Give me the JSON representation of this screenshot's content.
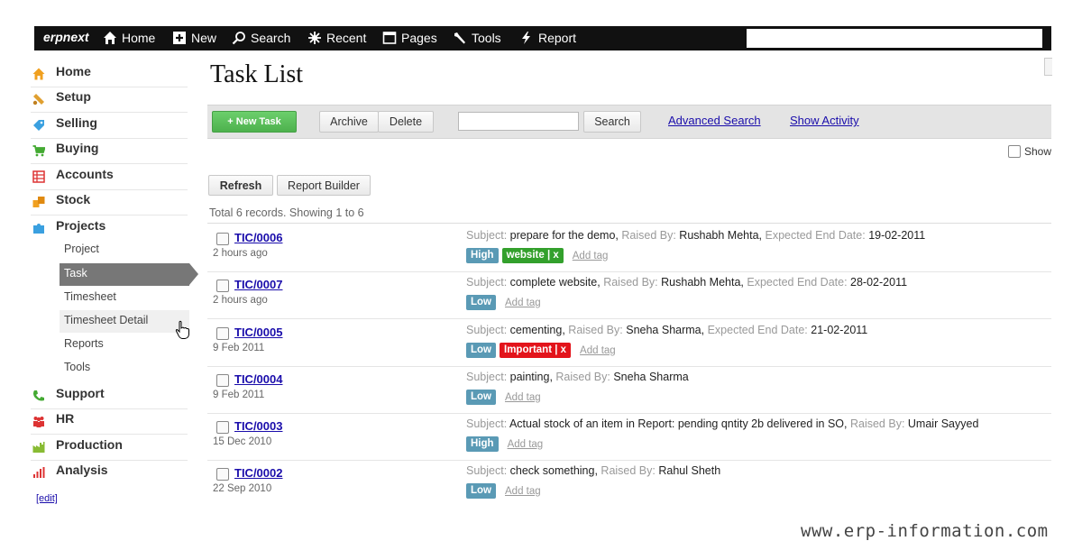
{
  "topbar": {
    "brand": "erpnext",
    "nav": [
      {
        "label": "Home",
        "icon": "home-icon"
      },
      {
        "label": "New",
        "icon": "plus-icon"
      },
      {
        "label": "Search",
        "icon": "search-icon"
      },
      {
        "label": "Recent",
        "icon": "star-icon"
      },
      {
        "label": "Pages",
        "icon": "page-icon"
      },
      {
        "label": "Tools",
        "icon": "wrench-icon"
      },
      {
        "label": "Report",
        "icon": "lightning-icon"
      }
    ]
  },
  "sidebar": {
    "items": [
      {
        "label": "Home",
        "icon": "home-icon",
        "color": "#f0a020"
      },
      {
        "label": "Setup",
        "icon": "tools-icon",
        "color": "#e0a030"
      },
      {
        "label": "Selling",
        "icon": "tag-icon",
        "color": "#3aa0e0"
      },
      {
        "label": "Buying",
        "icon": "cart-icon",
        "color": "#44aa33"
      },
      {
        "label": "Accounts",
        "icon": "ledger-icon",
        "color": "#dd3333"
      },
      {
        "label": "Stock",
        "icon": "boxes-icon",
        "color": "#f0a020"
      },
      {
        "label": "Projects",
        "icon": "puzzle-icon",
        "color": "#3aa0e0"
      }
    ],
    "subitems": [
      {
        "label": "Project"
      },
      {
        "label": "Task",
        "active": true
      },
      {
        "label": "Timesheet"
      },
      {
        "label": "Timesheet Detail"
      },
      {
        "label": "Reports"
      },
      {
        "label": "Tools"
      }
    ],
    "items_after": [
      {
        "label": "Support",
        "icon": "phone-icon",
        "color": "#44aa33"
      },
      {
        "label": "HR",
        "icon": "people-icon",
        "color": "#dd3333"
      },
      {
        "label": "Production",
        "icon": "factory-icon",
        "color": "#88bb33"
      },
      {
        "label": "Analysis",
        "icon": "bar-chart-icon",
        "color": "#dd3333"
      }
    ],
    "edit_label": "[edit]"
  },
  "main": {
    "title": "Task List",
    "toolbar": {
      "new_task": "+ New Task",
      "archive": "Archive",
      "delete": "Delete",
      "search_value": "",
      "search_button": "Search",
      "advanced_search": "Advanced Search",
      "show_activity": "Show Activity",
      "show_label": "Show"
    },
    "refresh": "Refresh",
    "report_builder": "Report Builder",
    "records_info": "Total 6 records. Showing 1 to 6",
    "labels": {
      "subject": "Subject:",
      "raised_by": "Raised By:",
      "expected_end": "Expected End Date:"
    },
    "add_tag": "Add tag",
    "tasks": [
      {
        "id": "TIC/0006",
        "when": "2 hours ago",
        "subject": "prepare for the demo,",
        "raised_by": "Rushabh Mehta,",
        "end_date": "19-02-2011",
        "tags": [
          {
            "text": "High",
            "color": "blue"
          },
          {
            "text": "website | x",
            "color": "green"
          }
        ]
      },
      {
        "id": "TIC/0007",
        "when": "2 hours ago",
        "subject": "complete website,",
        "raised_by": "Rushabh Mehta,",
        "end_date": "28-02-2011",
        "tags": [
          {
            "text": "Low",
            "color": "blue"
          }
        ]
      },
      {
        "id": "TIC/0005",
        "when": "9 Feb 2011",
        "subject": "cementing,",
        "raised_by": "Sneha Sharma,",
        "end_date": "21-02-2011",
        "tags": [
          {
            "text": "Low",
            "color": "blue"
          },
          {
            "text": "Important | x",
            "color": "red"
          }
        ]
      },
      {
        "id": "TIC/0004",
        "when": "9 Feb 2011",
        "subject": "painting,",
        "raised_by": "Sneha Sharma",
        "end_date": null,
        "tags": [
          {
            "text": "Low",
            "color": "blue"
          }
        ]
      },
      {
        "id": "TIC/0003",
        "when": "15 Dec 2010",
        "subject": "Actual stock of an item in Report: pending qntity 2b delivered in SO,",
        "raised_by": "Umair Sayyed",
        "end_date": null,
        "tags": [
          {
            "text": "High",
            "color": "blue"
          }
        ]
      },
      {
        "id": "TIC/0002",
        "when": "22 Sep 2010",
        "subject": "check something,",
        "raised_by": "Rahul Sheth",
        "end_date": null,
        "tags": [
          {
            "text": "Low",
            "color": "blue"
          }
        ]
      }
    ]
  },
  "watermark": "www.erp-information.com"
}
